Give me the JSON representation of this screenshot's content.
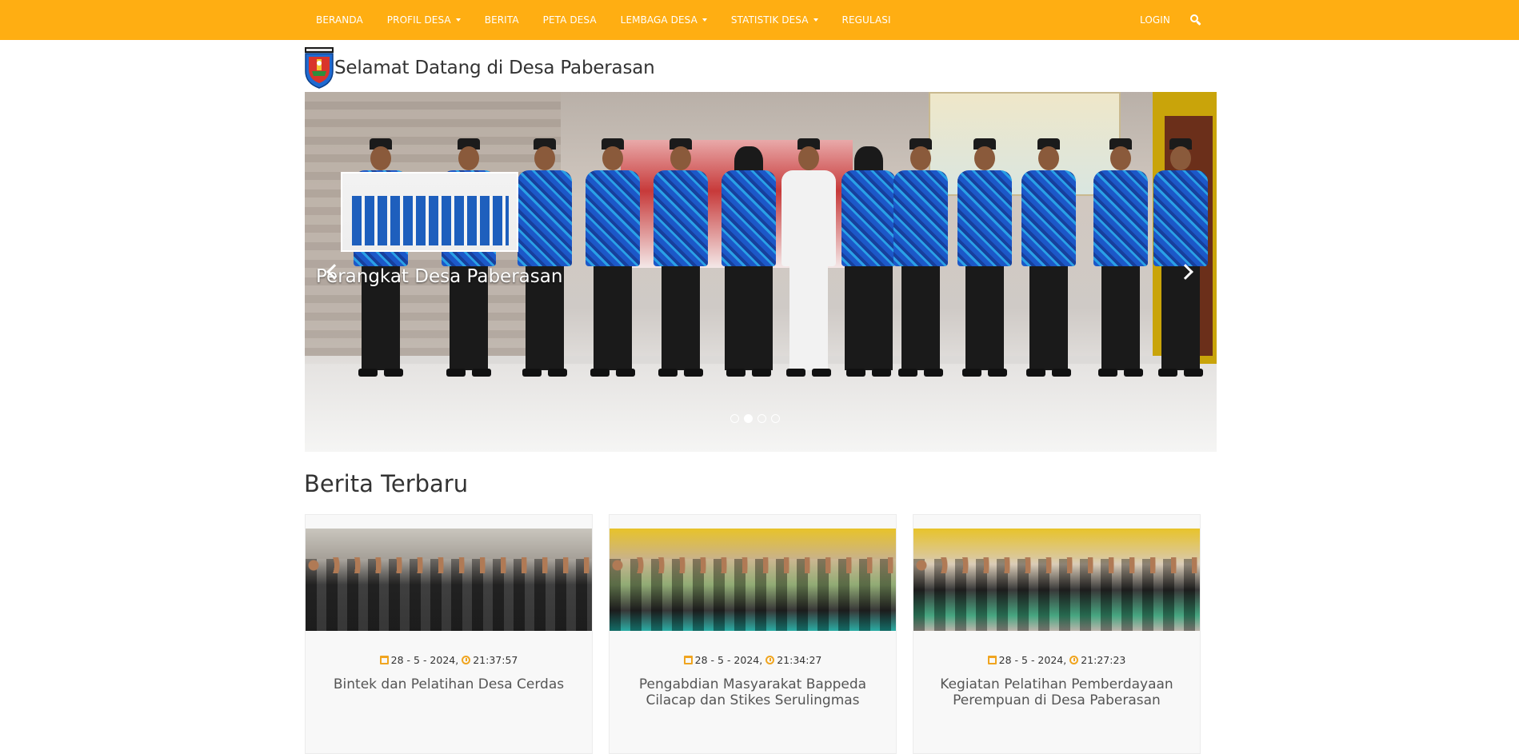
{
  "nav": {
    "items": [
      {
        "label": "BERANDA",
        "dropdown": false
      },
      {
        "label": "PROFIL DESA",
        "dropdown": true
      },
      {
        "label": "BERITA",
        "dropdown": false
      },
      {
        "label": "PETA DESA",
        "dropdown": false
      },
      {
        "label": "LEMBAGA DESA",
        "dropdown": true
      },
      {
        "label": "STATISTIK DESA",
        "dropdown": true
      },
      {
        "label": "REGULASI",
        "dropdown": false
      }
    ],
    "login_label": "LOGIN",
    "search_icon": "search-icon",
    "bar_color": "#FFAE12"
  },
  "header": {
    "title": "Selamat Datang di Desa Paberasan",
    "logo_icon": "cilacap-regency-emblem"
  },
  "carousel": {
    "caption": "Perangkat Desa Paberasan",
    "slide_count": 4,
    "active_index": 1
  },
  "news": {
    "section_title": "Berita Terbaru",
    "items": [
      {
        "date": "28 - 5 - 2024,",
        "time": "21:37:57",
        "title": "Bintek dan Pelatihan Desa Cerdas"
      },
      {
        "date": "28 - 5 - 2024,",
        "time": "21:34:27",
        "title": "Pengabdian Masyarakat Bappeda Cilacap dan Stikes Serulingmas"
      },
      {
        "date": "28 - 5 - 2024,",
        "time": "21:27:23",
        "title": "Kegiatan Pelatihan Pemberdayaan Perempuan di Desa Paberasan"
      }
    ],
    "icon_color": "#F0A520"
  }
}
